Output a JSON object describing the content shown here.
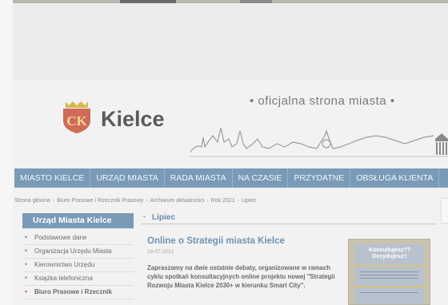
{
  "header": {
    "city": "Kielce",
    "logo_letters": "CK",
    "tagline": "• oficjalna strona miasta •"
  },
  "nav": {
    "items": [
      "MIASTO KIELCE",
      "URZĄD MIASTA",
      "RADA MIASTA",
      "NA CZASIE",
      "PRZYDATNE",
      "OBSŁUGA KLIENTA"
    ]
  },
  "breadcrumb": {
    "items": [
      "Strona główna",
      "Biuro Prasowe i Rzecznik Prasowy",
      "Archiwum aktualności",
      "Rok 2021",
      "Lipiec"
    ]
  },
  "sidebar": {
    "title": "Urząd Miasta Kielce",
    "items": [
      "Podstawowe dane",
      "Organizacja Urzędu Miasta",
      "Kierownictwo Urzędu",
      "Książka telefoniczna",
      "Biuro Prasowe i Rzecznik"
    ]
  },
  "section": {
    "title": "Lipiec"
  },
  "article": {
    "title": "Online o Strategii miasta Kielce",
    "date": "19-07-2021",
    "body": "Zapraszamy na dwie ostatnie debaty, organizowane w ramach cyklu spotkań konsultacyjnych online projektu nowej \"Strategii Rozwoju Miasta Kielce 2030+ w kierunku Smart City\".",
    "thumb_text": "Konsultujesz?? Decydujesz!!"
  },
  "colors": {
    "accent": "#7a9bb8",
    "link": "#6e93b4",
    "logo": "#d06a5a"
  }
}
